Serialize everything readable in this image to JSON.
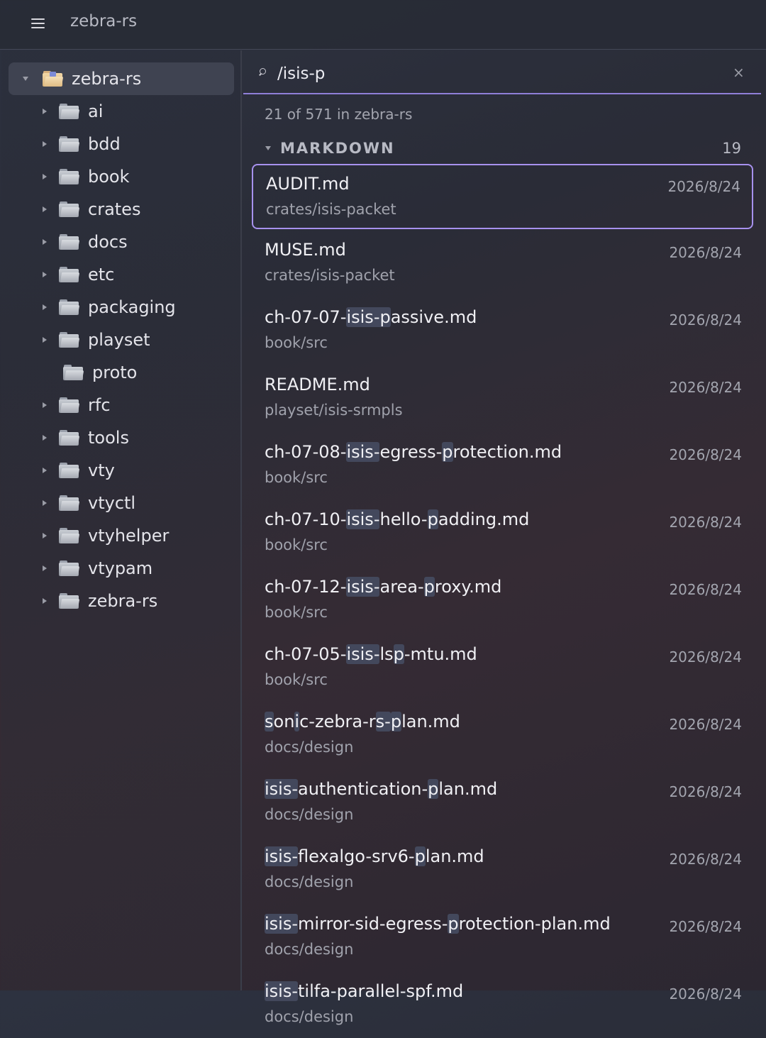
{
  "app": {
    "title": "zebra-rs"
  },
  "sidebar": {
    "root": {
      "label": "zebra-rs"
    },
    "items": [
      {
        "label": "ai",
        "expandable": true
      },
      {
        "label": "bdd",
        "expandable": true
      },
      {
        "label": "book",
        "expandable": true
      },
      {
        "label": "crates",
        "expandable": true
      },
      {
        "label": "docs",
        "expandable": true
      },
      {
        "label": "etc",
        "expandable": true
      },
      {
        "label": "packaging",
        "expandable": true
      },
      {
        "label": "playset",
        "expandable": true
      },
      {
        "label": "proto",
        "expandable": false
      },
      {
        "label": "rfc",
        "expandable": true
      },
      {
        "label": "tools",
        "expandable": true
      },
      {
        "label": "vty",
        "expandable": true
      },
      {
        "label": "vtyctl",
        "expandable": true
      },
      {
        "label": "vtyhelper",
        "expandable": true
      },
      {
        "label": "vtypam",
        "expandable": true
      },
      {
        "label": "zebra-rs",
        "expandable": true
      }
    ]
  },
  "search": {
    "value": "/isis-p",
    "clear": "×"
  },
  "summary": "21 of 571 in zebra-rs",
  "group": {
    "name": "MARKDOWN",
    "count": "19"
  },
  "results": [
    {
      "segments": [
        {
          "t": "AUDIT.md",
          "h": false
        }
      ],
      "path": "crates/isis-packet",
      "date": "2026/8/24",
      "selected": true
    },
    {
      "segments": [
        {
          "t": "MUSE.md",
          "h": false
        }
      ],
      "path": "crates/isis-packet",
      "date": "2026/8/24"
    },
    {
      "segments": [
        {
          "t": "ch-07-07-",
          "h": false
        },
        {
          "t": "isis-p",
          "h": true
        },
        {
          "t": "assive.md",
          "h": false
        }
      ],
      "path": "book/src",
      "date": "2026/8/24"
    },
    {
      "segments": [
        {
          "t": "README.md",
          "h": false
        }
      ],
      "path": "playset/isis-srmpls",
      "date": "2026/8/24"
    },
    {
      "segments": [
        {
          "t": "ch-07-08-",
          "h": false
        },
        {
          "t": "isis-",
          "h": true
        },
        {
          "t": "egress-",
          "h": false
        },
        {
          "t": "p",
          "h": true
        },
        {
          "t": "rotection.md",
          "h": false
        }
      ],
      "path": "book/src",
      "date": "2026/8/24"
    },
    {
      "segments": [
        {
          "t": "ch-07-10-",
          "h": false
        },
        {
          "t": "isis-",
          "h": true
        },
        {
          "t": "hello-",
          "h": false
        },
        {
          "t": "p",
          "h": true
        },
        {
          "t": "adding.md",
          "h": false
        }
      ],
      "path": "book/src",
      "date": "2026/8/24"
    },
    {
      "segments": [
        {
          "t": "ch-07-12-",
          "h": false
        },
        {
          "t": "isis-",
          "h": true
        },
        {
          "t": "area-",
          "h": false
        },
        {
          "t": "p",
          "h": true
        },
        {
          "t": "roxy.md",
          "h": false
        }
      ],
      "path": "book/src",
      "date": "2026/8/24"
    },
    {
      "segments": [
        {
          "t": "ch-07-05-",
          "h": false
        },
        {
          "t": "isis-",
          "h": true
        },
        {
          "t": "ls",
          "h": false
        },
        {
          "t": "p",
          "h": true
        },
        {
          "t": "-mtu.md",
          "h": false
        }
      ],
      "path": "book/src",
      "date": "2026/8/24"
    },
    {
      "segments": [
        {
          "t": "s",
          "h": true
        },
        {
          "t": "on",
          "h": false
        },
        {
          "t": "i",
          "h": true
        },
        {
          "t": "c-zebra-r",
          "h": false
        },
        {
          "t": "s-",
          "h": true
        },
        {
          "t": "p",
          "h": true
        },
        {
          "t": "lan.md",
          "h": false
        }
      ],
      "path": "docs/design",
      "date": "2026/8/24"
    },
    {
      "segments": [
        {
          "t": "isis-",
          "h": true
        },
        {
          "t": "authentication-",
          "h": false
        },
        {
          "t": "p",
          "h": true
        },
        {
          "t": "lan.md",
          "h": false
        }
      ],
      "path": "docs/design",
      "date": "2026/8/24"
    },
    {
      "segments": [
        {
          "t": "isis-",
          "h": true
        },
        {
          "t": "flexalgo-srv6-",
          "h": false
        },
        {
          "t": "p",
          "h": true
        },
        {
          "t": "lan.md",
          "h": false
        }
      ],
      "path": "docs/design",
      "date": "2026/8/24"
    },
    {
      "segments": [
        {
          "t": "isis-",
          "h": true
        },
        {
          "t": "mirror-sid-egress-",
          "h": false
        },
        {
          "t": "p",
          "h": true
        },
        {
          "t": "rotection-plan.md",
          "h": false
        }
      ],
      "path": "docs/design",
      "date": "2026/8/24"
    },
    {
      "segments": [
        {
          "t": "isis-",
          "h": true
        },
        {
          "t": "tilfa-parallel-spf.md",
          "h": false
        }
      ],
      "path": "docs/design",
      "date": "2026/8/24"
    }
  ]
}
